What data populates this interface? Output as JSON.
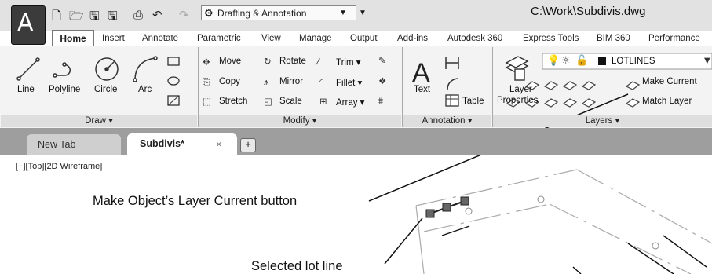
{
  "titlebar": {
    "app_letter": "A",
    "workspace": "Drafting & Annotation",
    "document_title": "C:\\Work\\Subdivis.dwg"
  },
  "ribbon": {
    "tabs": [
      "Home",
      "Insert",
      "Annotate",
      "Parametric",
      "View",
      "Manage",
      "Output",
      "Add-ins",
      "Autodesk 360",
      "Express Tools",
      "BIM 360",
      "Performance"
    ],
    "draw": {
      "title": "Draw ▾",
      "line": "Line",
      "polyline": "Polyline",
      "circle": "Circle",
      "arc": "Arc"
    },
    "modify": {
      "title": "Modify ▾",
      "move": "Move",
      "rotate": "Rotate",
      "trim": "Trim ▾",
      "copy": "Copy",
      "mirror": "Mirror",
      "fillet": "Fillet ▾",
      "stretch": "Stretch",
      "scale": "Scale",
      "array": "Array ▾"
    },
    "annotation": {
      "title": "Annotation ▾",
      "text": "Text",
      "table": "Table"
    },
    "layers": {
      "title": "Layers ▾",
      "layer_properties_1": "Layer",
      "layer_properties_2": "Properties",
      "layer_name": "LOTLINES",
      "make_current": "Make Current",
      "match_layer": "Match Layer"
    }
  },
  "file_tabs": {
    "new_tab": "New Tab",
    "active": "Subdivis*",
    "close": "×",
    "add": "+"
  },
  "viewport": {
    "controls": "[−][Top][2D Wireframe]"
  },
  "callouts": {
    "make_current": "Make Object’s Layer Current button",
    "selected": "Selected lot line"
  }
}
